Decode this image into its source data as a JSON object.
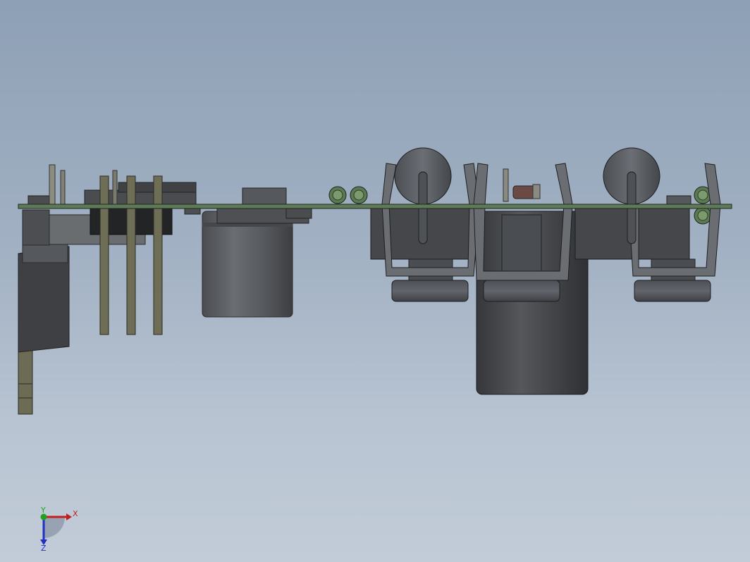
{
  "view": {
    "background_top": "#8ea0b6",
    "background_bottom": "#c2ccd8"
  },
  "triad": {
    "x_label": "X",
    "y_label": "Y",
    "z_label": "Z",
    "x_color": "#c02020",
    "y_color": "#20a020",
    "z_color": "#2030c0"
  },
  "colors": {
    "pcb": "#5f7a58",
    "component_dark": "#3b3d40",
    "component_body": "#55585c",
    "pin": "#707056",
    "capacitor": "#5e6166"
  }
}
